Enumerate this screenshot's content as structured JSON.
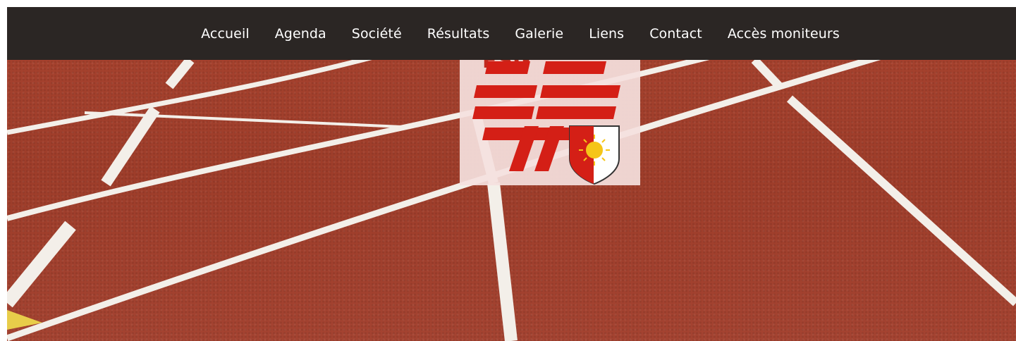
{
  "nav": {
    "items": [
      {
        "label": "Accueil"
      },
      {
        "label": "Agenda"
      },
      {
        "label": "Société"
      },
      {
        "label": "Résultats"
      },
      {
        "label": "Galerie"
      },
      {
        "label": "Liens"
      },
      {
        "label": "Contact"
      },
      {
        "label": "Accès moniteurs"
      }
    ]
  },
  "logo": {
    "partial_text": "FSG"
  },
  "colors": {
    "navbar_bg": "#2b2624",
    "track": "#a8432f",
    "logo_red": "#d41f16",
    "shield_sun": "#f5c518"
  }
}
